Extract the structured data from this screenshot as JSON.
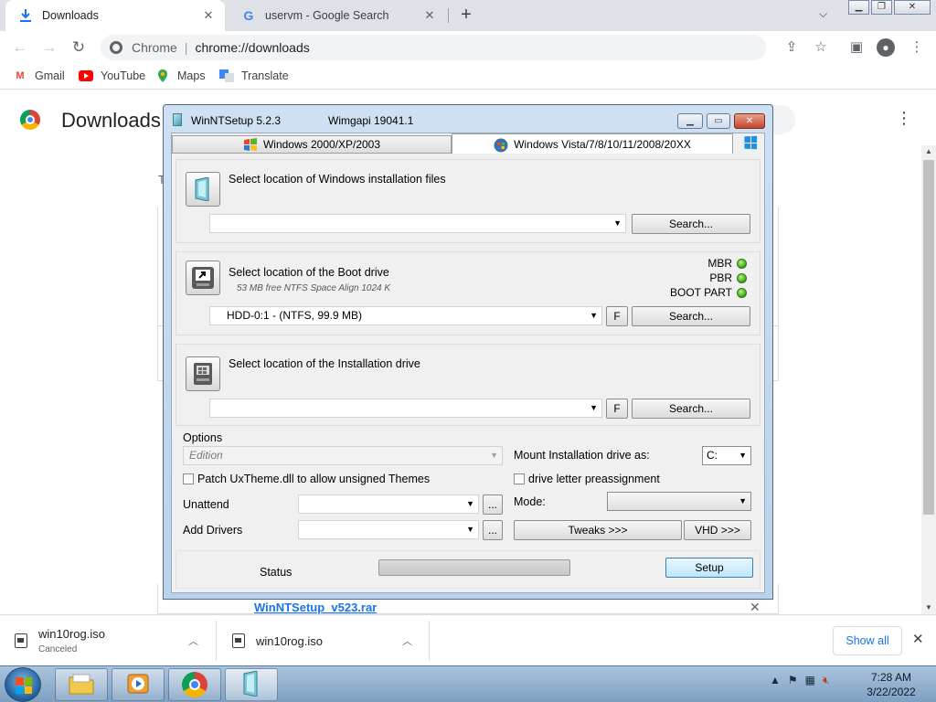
{
  "browser": {
    "tabs": [
      {
        "label": "Downloads",
        "icon": "download-icon",
        "active": true
      },
      {
        "label": "uservm - Google Search",
        "icon": "google-icon",
        "active": false
      }
    ],
    "omnibox": {
      "site_label": "Chrome",
      "url": "chrome://downloads"
    },
    "bookmarks": [
      {
        "label": "Gmail",
        "icon": "gmail-icon",
        "color": "#ea4335"
      },
      {
        "label": "YouTube",
        "icon": "youtube-icon",
        "color": "#ff0000"
      },
      {
        "label": "Maps",
        "icon": "maps-icon",
        "color": "#34a853"
      },
      {
        "label": "Translate",
        "icon": "translate-icon",
        "color": "#4285f4"
      }
    ]
  },
  "downloads_page": {
    "title": "Downloads",
    "date_heading_partial": "T",
    "visible_file_link": "WinNTSetup_v523.rar"
  },
  "download_shelf": {
    "items": [
      {
        "name": "win10rog.iso",
        "status": "Canceled"
      },
      {
        "name": "win10rog.iso",
        "status": ""
      }
    ],
    "show_all_label": "Show all"
  },
  "winntsetup": {
    "title": "WinNTSetup 5.2.3",
    "wimgapi": "Wimgapi 19041.1",
    "tabs": [
      {
        "label": "Windows 2000/XP/2003",
        "active": false
      },
      {
        "label": "Windows Vista/7/8/10/11/2008/20XX",
        "active": true
      }
    ],
    "install_files": {
      "label": "Select location of Windows installation files",
      "value": "",
      "search_label": "Search..."
    },
    "boot_drive": {
      "label": "Select location of the Boot drive",
      "sublabel": "53 MB free NTFS Space Align 1024 K",
      "value": "HDD-0:1 -   (NTFS, 99.9 MB)",
      "f_label": "F",
      "search_label": "Search...",
      "indicators": [
        {
          "label": "MBR",
          "status": "green"
        },
        {
          "label": "PBR",
          "status": "green"
        },
        {
          "label": "BOOT PART",
          "status": "green"
        }
      ]
    },
    "install_drive": {
      "label": "Select location of the Installation drive",
      "value": "",
      "f_label": "F",
      "search_label": "Search..."
    },
    "options": {
      "heading": "Options",
      "edition_placeholder": "Edition",
      "patch_uxtheme_label": "Patch UxTheme.dll to allow unsigned Themes",
      "patch_uxtheme_checked": false,
      "mount_label": "Mount Installation drive as:",
      "mount_value": "C:",
      "drive_letter_label": "drive letter preassignment",
      "drive_letter_checked": false,
      "unattend_label": "Unattend",
      "unattend_value": "",
      "add_drivers_label": "Add Drivers",
      "add_drivers_value": "",
      "browse_label": "...",
      "mode_label": "Mode:",
      "mode_value": "",
      "tweaks_label": "Tweaks >>>",
      "vhd_label": "VHD >>>"
    },
    "status_label": "Status",
    "setup_label": "Setup"
  },
  "taskbar": {
    "clock_time": "7:28 AM",
    "clock_date": "3/22/2022",
    "apps": [
      "explorer-icon",
      "media-player-icon",
      "chrome-icon",
      "winntsetup-icon"
    ]
  }
}
